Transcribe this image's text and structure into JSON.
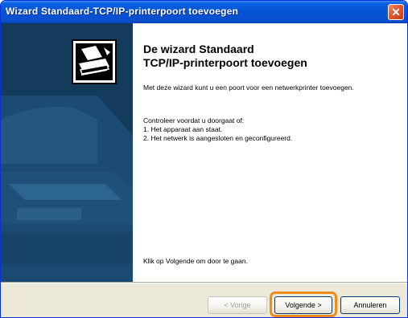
{
  "window": {
    "title": "Wizard Standaard-TCP/IP-printerpoort toevoegen",
    "close_symbol": "✕"
  },
  "wizard": {
    "heading_line1": "De wizard Standaard",
    "heading_line2": "TCP/IP-printerpoort toevoegen",
    "intro": "Met deze wizard kunt u een poort voor een netwerkprinter toevoegen.",
    "check_intro": "Controleer voordat u doorgaat of:",
    "check_1": "1. Het apparaat aan staat.",
    "check_2": "2. Het netwerk is aangesloten en geconfigureerd.",
    "continue_text": "Klik op Volgende om door te gaan."
  },
  "buttons": {
    "back_label": "< Vorige",
    "next_label": "Volgende >",
    "cancel_label": "Annuleren"
  },
  "colors": {
    "titlebar": "#0553d6",
    "side_panel": "#143a5c",
    "highlight": "#f08a18"
  },
  "icons": {
    "close": "close-icon",
    "wizard": "printer-wizard-icon"
  }
}
